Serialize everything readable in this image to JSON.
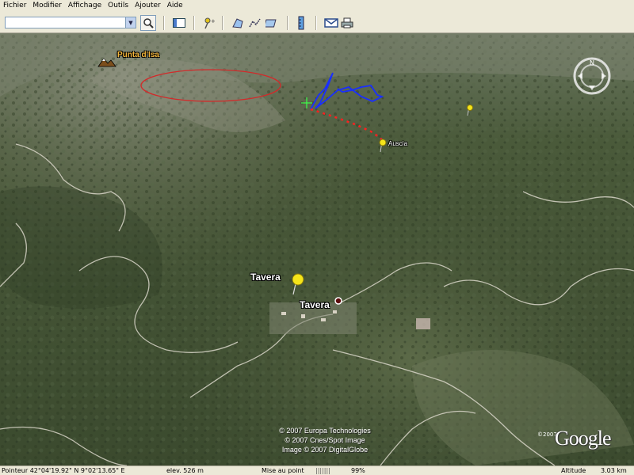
{
  "menu": {
    "items": [
      {
        "label": "Fichier"
      },
      {
        "label": "Modifier"
      },
      {
        "label": "Affichage"
      },
      {
        "label": "Outils"
      },
      {
        "label": "Ajouter"
      },
      {
        "label": "Aide"
      }
    ]
  },
  "search": {
    "value": ""
  },
  "toolbar": {
    "icons": [
      "search-icon",
      "sidebar-icon",
      "add-placemark-icon",
      "add-polygon-icon",
      "add-path-icon",
      "add-image-overlay-icon",
      "ruler-icon",
      "email-icon",
      "print-icon"
    ]
  },
  "map": {
    "labels": {
      "peak": "Punta d'Isa",
      "village_pin": "Tavera",
      "village_dot": "Tavera",
      "small_pin": "Auscia"
    },
    "copyright": [
      "© 2007 Europa Technologies",
      "© 2007 Cnes/Spot Image",
      "Image © 2007 DigitalGlobe"
    ],
    "logo": {
      "year": "©2007",
      "text": "Google"
    },
    "colors": {
      "path_blue": "#1a2fff",
      "path_red": "#ff2020",
      "ellipse_red": "#d22a2a",
      "pin_yellow": "#f5e51a"
    }
  },
  "status": {
    "pointer": "Pointeur 42°04'19.92\" N    9°02'13.65\" E",
    "elev": "elev.     526 m",
    "loading_label": "Mise au point",
    "loading_bar": "|||||||",
    "loading_percent": "99%",
    "altitude_label": "Altitude",
    "altitude_value": "3.03 km"
  }
}
